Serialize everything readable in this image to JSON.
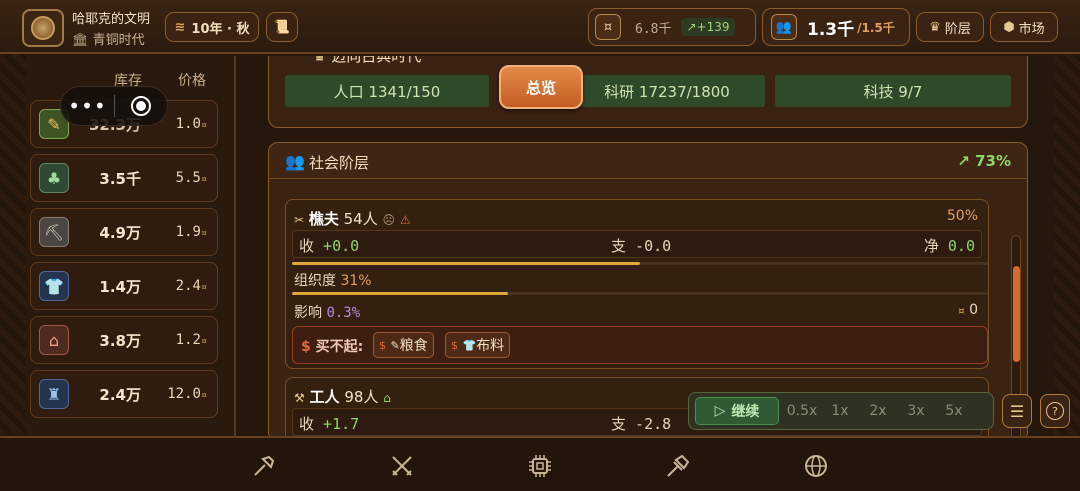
{
  "header": {
    "civ_name": "哈耶克的文明",
    "civ_age": "青铜时代",
    "date": "10年 · 秋",
    "silver": "6.8千",
    "silver_rate": "+139",
    "population": "1.3千",
    "population_cap": "/1.5千",
    "strata_button": "阶层",
    "market_button": "市场"
  },
  "left_panel": {
    "col_stock": "库存",
    "col_price": "价格",
    "resources": [
      {
        "icon": "wheat-icon",
        "stock": "32.3万",
        "price": "1.0"
      },
      {
        "icon": "wood-icon",
        "stock": "3.5千",
        "price": "5.5"
      },
      {
        "icon": "pickaxe-icon",
        "stock": "4.9万",
        "price": "1.9"
      },
      {
        "icon": "cloth-icon",
        "stock": "1.4万",
        "price": "2.4"
      },
      {
        "icon": "house-icon",
        "stock": "3.8万",
        "price": "1.2"
      },
      {
        "icon": "anvil-icon",
        "stock": "2.4万",
        "price": "12.0"
      }
    ]
  },
  "era": {
    "title": "迈向古典时代",
    "overview_button": "总览",
    "population_stat": "人口 1341/150",
    "research_stat": "科研 17237/1800",
    "tech_stat": "科技 9/7"
  },
  "classes": {
    "title": "社会阶层",
    "approval": "73%",
    "woodcutter": {
      "name": "樵夫",
      "count": "54人",
      "share": "50%",
      "income_label": "收",
      "income": "+0.0",
      "expense_label": "支",
      "expense": "-0.0",
      "net_label": "净",
      "net": "0.0",
      "org_label": "组织度",
      "org": "31%",
      "org_level": 0.31,
      "income_level": 0.5,
      "influence_label": "影响",
      "influence": "0.3%",
      "coin_value": "0",
      "cannot_afford": "买不起:",
      "goods": [
        "粮食",
        "布料"
      ]
    },
    "worker": {
      "name": "工人",
      "count": "98人",
      "income_label": "收",
      "income": "+1.7",
      "expense_label": "支",
      "expense": "-2.8"
    }
  },
  "speed": {
    "play": "继续",
    "options": [
      "0.5x",
      "1x",
      "2x",
      "3x",
      "5x"
    ]
  },
  "colors": {
    "accent": "#d9682f",
    "positive": "#8fd66a",
    "influence": "#b98ae0",
    "org": "#e1a73b"
  }
}
